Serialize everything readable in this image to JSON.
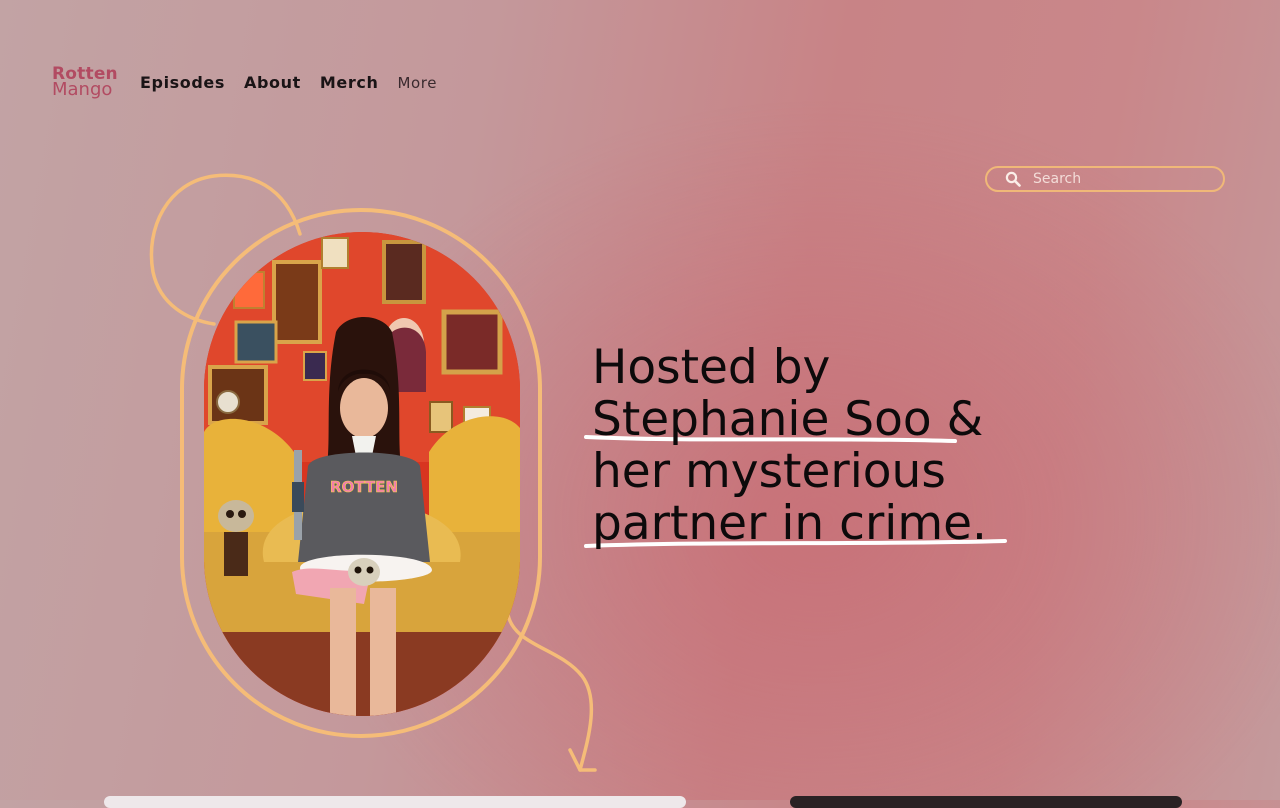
{
  "logo": {
    "line1": "Rotten",
    "line2": "Mango"
  },
  "nav": {
    "episodes": "Episodes",
    "about": "About",
    "merch": "Merch",
    "more": "More"
  },
  "search": {
    "placeholder": "Search",
    "icon": "search-icon"
  },
  "hero": {
    "image_alt": "Stephanie Soo sitting on a couch holding a knife and a skull",
    "sweater_text": "ROTTEN",
    "headline": {
      "line1": "Hosted by",
      "line2": "Stephanie Soo &",
      "line3": "her mysterious",
      "line4": "partner in crime."
    }
  },
  "colors": {
    "brand": "#b24b62",
    "accent_outline": "#f5bc78",
    "text": "#0d0a0b"
  }
}
